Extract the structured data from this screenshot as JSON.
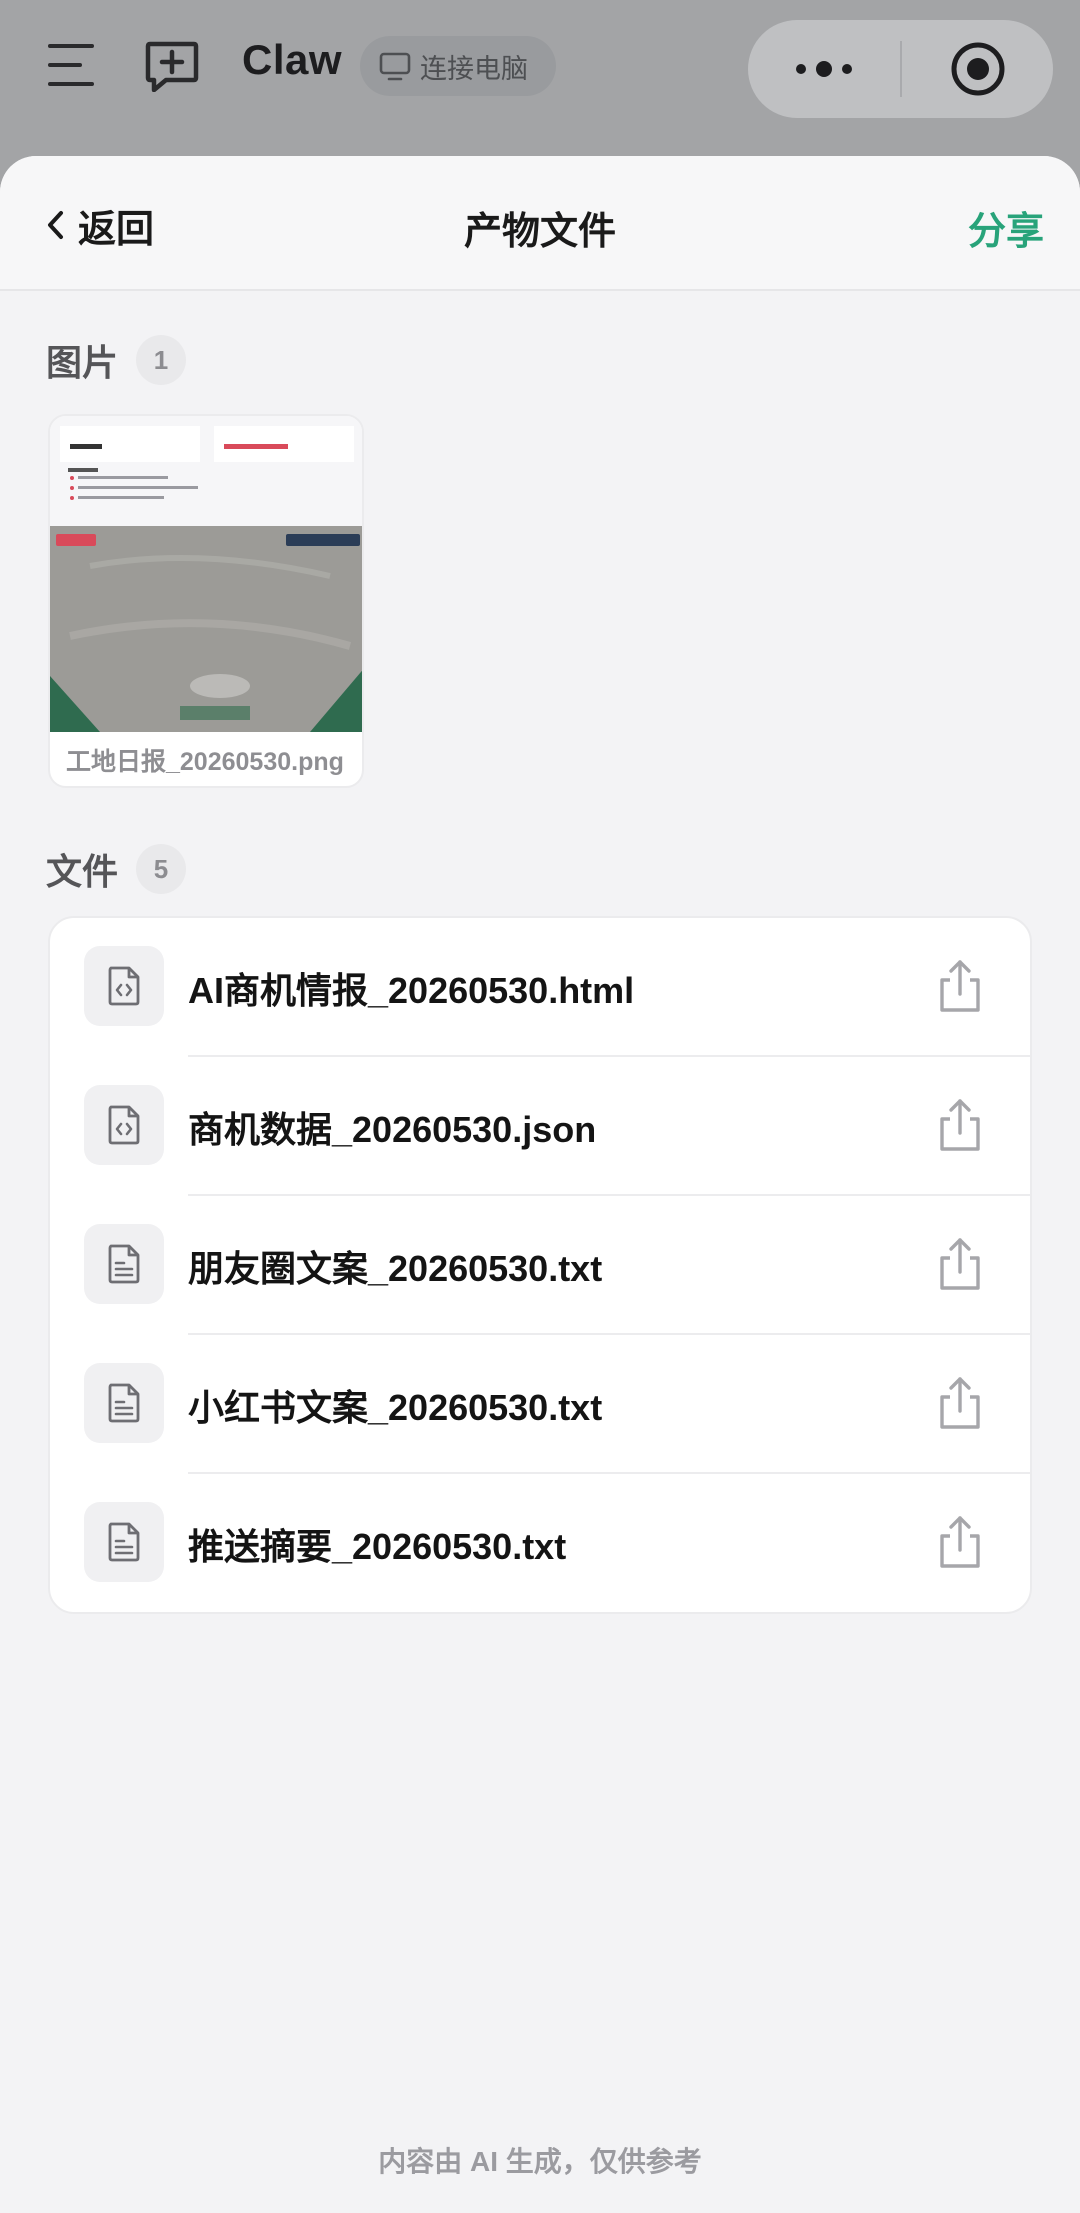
{
  "header": {
    "app_title": "Claw",
    "connect_label": "连接电脑"
  },
  "nav": {
    "back_label": "返回",
    "title": "产物文件",
    "share_label": "分享"
  },
  "images_section": {
    "label": "图片",
    "count": "1",
    "items": [
      {
        "name": "工地日报_20260530.png"
      }
    ]
  },
  "files_section": {
    "label": "文件",
    "count": "5",
    "items": [
      {
        "name": "AI商机情报_20260530.html",
        "icon": "code-file-icon"
      },
      {
        "name": "商机数据_20260530.json",
        "icon": "code-file-icon"
      },
      {
        "name": "朋友圈文案_20260530.txt",
        "icon": "text-file-icon"
      },
      {
        "name": "小红书文案_20260530.txt",
        "icon": "text-file-icon"
      },
      {
        "name": "推送摘要_20260530.txt",
        "icon": "text-file-icon"
      }
    ]
  },
  "footer": {
    "note": "内容由 AI 生成，仅供参考"
  },
  "colors": {
    "accent": "#28a37a",
    "overlay": "#a3a4a6",
    "sheet_bg": "#f3f3f5"
  }
}
